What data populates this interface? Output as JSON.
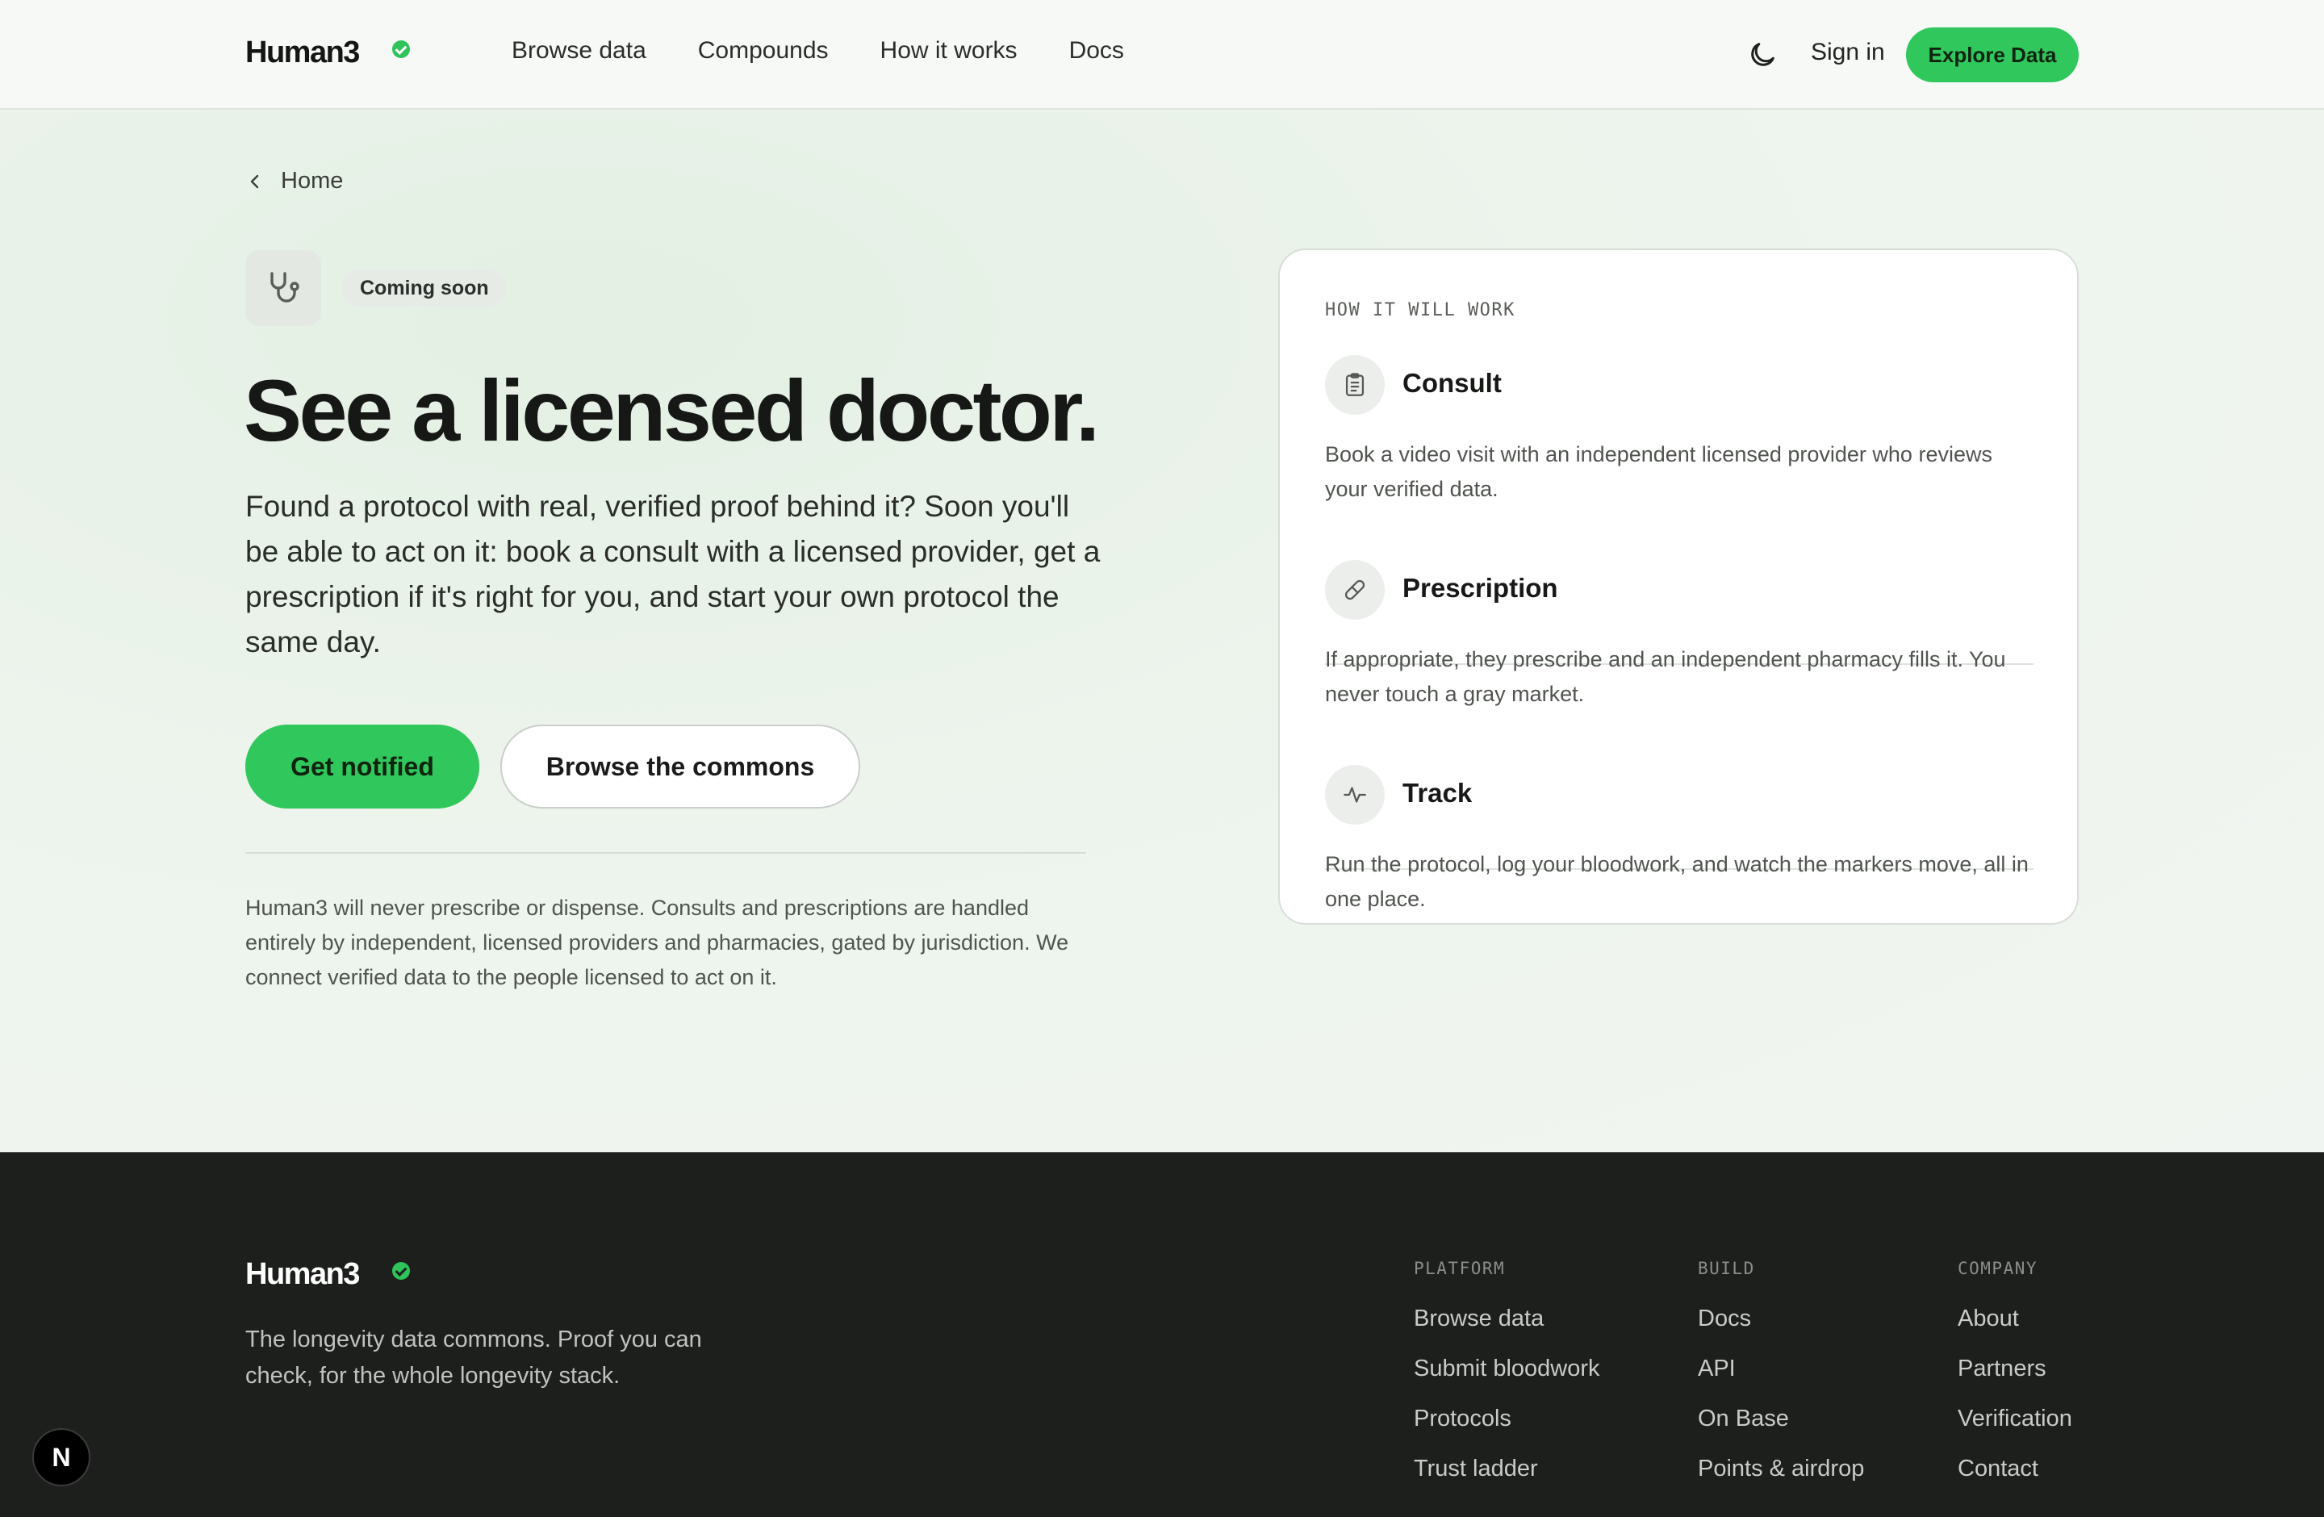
{
  "header": {
    "logo": "Human3",
    "nav": [
      "Browse data",
      "Compounds",
      "How it works",
      "Docs"
    ],
    "sign_in": "Sign in",
    "explore": "Explore Data"
  },
  "icons": {
    "verified": "verified-check-icon",
    "theme": "moon-icon",
    "back": "chevron-left-icon",
    "stethoscope": "stethoscope-icon",
    "consult": "clipboard-icon",
    "prescription": "pill-icon",
    "track": "activity-icon"
  },
  "colors": {
    "accent": "#30c75c",
    "footer_bg": "#1d1f1d"
  },
  "hero": {
    "back_label": "Home",
    "badge": "Coming soon",
    "title": "See a licensed doctor.",
    "description": "Found a protocol with real, verified proof behind it? Soon you'll be able to act on it: book a consult with a licensed provider, get a prescription if it's right for you, and start your own protocol the same day.",
    "primary_cta": "Get notified",
    "secondary_cta": "Browse the commons",
    "disclaimer": "Human3 will never prescribe or dispense. Consults and prescriptions are handled entirely by independent, licensed providers and pharmacies, gated by jurisdiction. We connect verified data to the people licensed to act on it."
  },
  "card": {
    "eyebrow": "HOW IT WILL WORK",
    "steps": [
      {
        "title": "Consult",
        "description": "Book a video visit with an independent licensed provider who reviews your verified data."
      },
      {
        "title": "Prescription",
        "description": "If appropriate, they prescribe and an independent pharmacy fills it. You never touch a gray market."
      },
      {
        "title": "Track",
        "description": "Run the protocol, log your bloodwork, and watch the markers move, all in one place."
      }
    ]
  },
  "footer": {
    "logo": "Human3",
    "tagline": "The longevity data commons. Proof you can check, for the whole longevity stack.",
    "columns": [
      {
        "title": "PLATFORM",
        "links": [
          "Browse data",
          "Submit bloodwork",
          "Protocols",
          "Trust ladder"
        ]
      },
      {
        "title": "BUILD",
        "links": [
          "Docs",
          "API",
          "On Base",
          "Points & airdrop"
        ]
      },
      {
        "title": "COMPANY",
        "links": [
          "About",
          "Partners",
          "Verification",
          "Contact"
        ]
      }
    ]
  },
  "dev_badge": "N"
}
